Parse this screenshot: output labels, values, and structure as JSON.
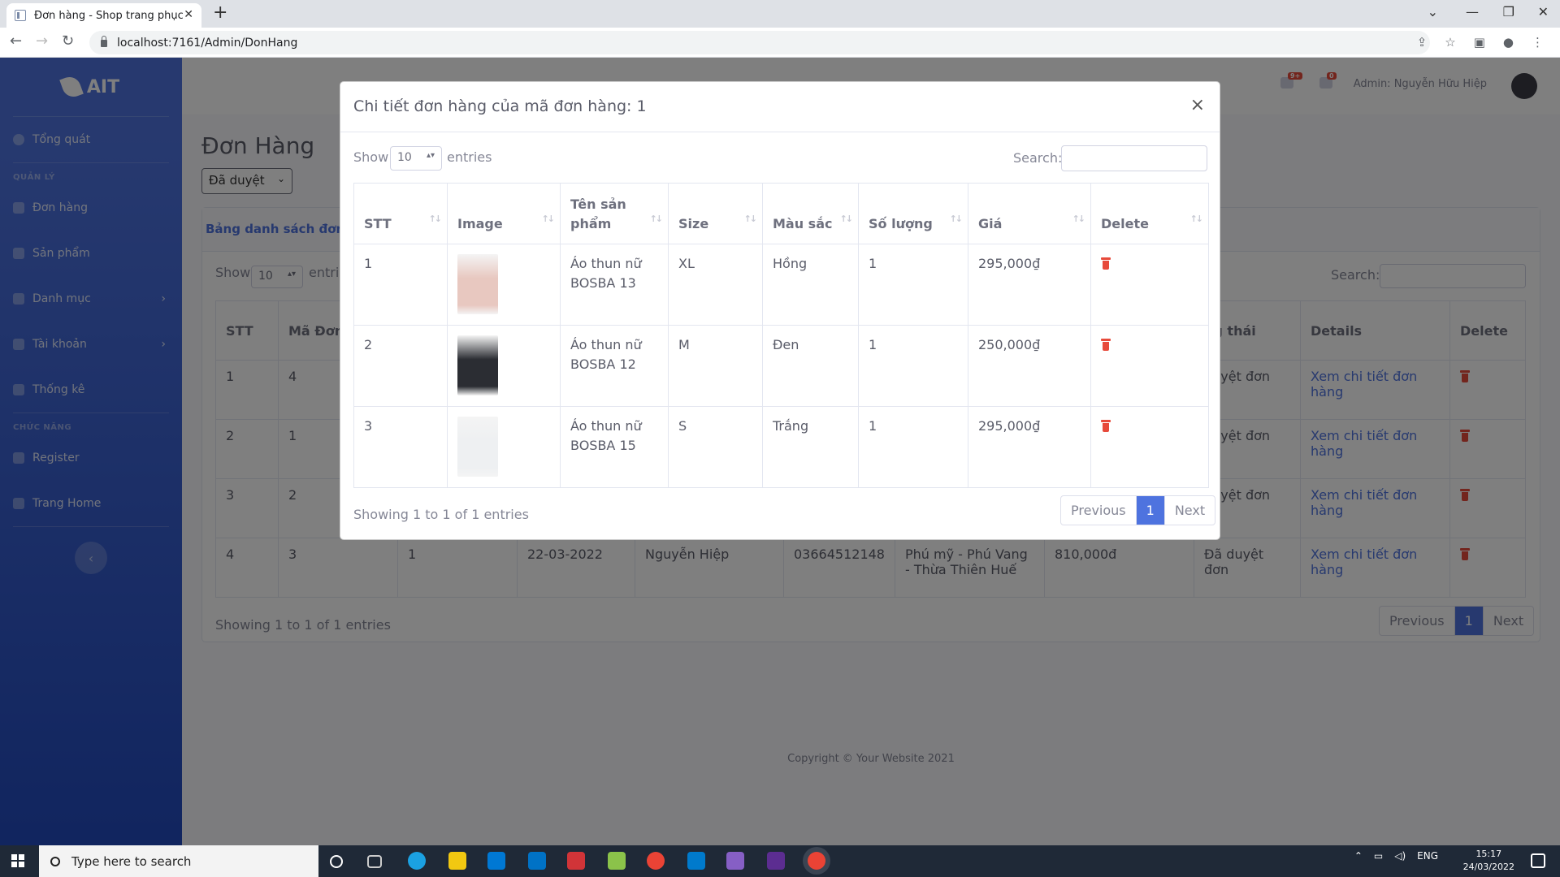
{
  "browser": {
    "tab_title": "Đơn hàng - Shop trang phục",
    "url": "localhost:7161/Admin/DonHang"
  },
  "sidebar": {
    "brand": "AIT",
    "overview": "Tổng quát",
    "section_manage": "QUẢN LÝ",
    "items": [
      {
        "label": "Đơn hàng"
      },
      {
        "label": "Sản phẩm"
      },
      {
        "label": "Danh mục"
      },
      {
        "label": "Tài khoản"
      },
      {
        "label": "Thống kê"
      }
    ],
    "section_function": "CHỨC NĂNG",
    "items2": [
      {
        "label": "Register"
      },
      {
        "label": "Trang Home"
      }
    ]
  },
  "topbar": {
    "alerts_badge": "9+",
    "messages_badge": "0",
    "user": "Admin: Nguyễn Hữu Hiệp"
  },
  "page": {
    "title": "Đơn Hàng",
    "status_filter": "Đã duyệt",
    "card_title": "Bảng danh sách đơn h"
  },
  "bg_table": {
    "show": "Show",
    "show_value": "10",
    "entries": "entri",
    "search_label": "Search:",
    "headers": {
      "stt": "STT",
      "ma_don": "Mã Đơn",
      "trang_thai": "ng thái",
      "details": "Details",
      "delete": "Delete"
    },
    "rows": [
      {
        "stt": "1",
        "ma": "4",
        "status": "duyệt đơn",
        "link": "Xem chi tiết đơn hàng"
      },
      {
        "stt": "2",
        "ma": "1",
        "status": "duyệt đơn",
        "link": "Xem chi tiết đơn hàng"
      },
      {
        "stt": "3",
        "ma": "2",
        "status": "duyệt đơn",
        "link": "Xem chi tiết đơn hàng"
      },
      {
        "stt": "4",
        "ma": "3",
        "col3": "1",
        "date": "22-03-2022",
        "name": "Nguyễn Hiệp",
        "phone": "03664512148",
        "address": "Phú mỹ - Phú Vang - Thừa Thiên Huế",
        "total": "810,000đ",
        "status": "Đã duyệt đơn",
        "link": "Xem chi tiết đơn hàng"
      }
    ],
    "showing": "Showing 1 to 1 of 1 entries",
    "pager": {
      "prev": "Previous",
      "page": "1",
      "next": "Next"
    }
  },
  "footer": "Copyright © Your Website 2021",
  "modal": {
    "title": "Chi tiết đơn hàng của mã đơn hàng: 1",
    "close": "×",
    "show": "Show",
    "show_value": "10",
    "entries": "entries",
    "search_label": "Search:",
    "headers": {
      "stt": "STT",
      "image": "Image",
      "name": "Tên sản phẩm",
      "size": "Size",
      "color": "Màu sắc",
      "qty": "Số lượng",
      "price": "Giá",
      "delete": "Delete"
    },
    "rows": [
      {
        "stt": "1",
        "name": "Áo thun nữ BOSBA 13",
        "size": "XL",
        "color": "Hồng",
        "qty": "1",
        "price": "295,000₫",
        "img_color": "#e8c8c0"
      },
      {
        "stt": "2",
        "name": "Áo thun nữ BOSBA 12",
        "size": "M",
        "color": "Đen",
        "qty": "1",
        "price": "250,000₫",
        "img_color": "#2b2d33"
      },
      {
        "stt": "3",
        "name": "Áo thun nữ BOSBA 15",
        "size": "S",
        "color": "Trắng",
        "qty": "1",
        "price": "295,000₫",
        "img_color": "#eef0f2"
      }
    ],
    "showing": "Showing 1 to 1 of 1 entries",
    "pager": {
      "prev": "Previous",
      "page": "1",
      "next": "Next"
    }
  },
  "taskbar": {
    "search_placeholder": "Type here to search",
    "lang": "ENG",
    "time": "15:17",
    "date": "24/03/2022"
  }
}
